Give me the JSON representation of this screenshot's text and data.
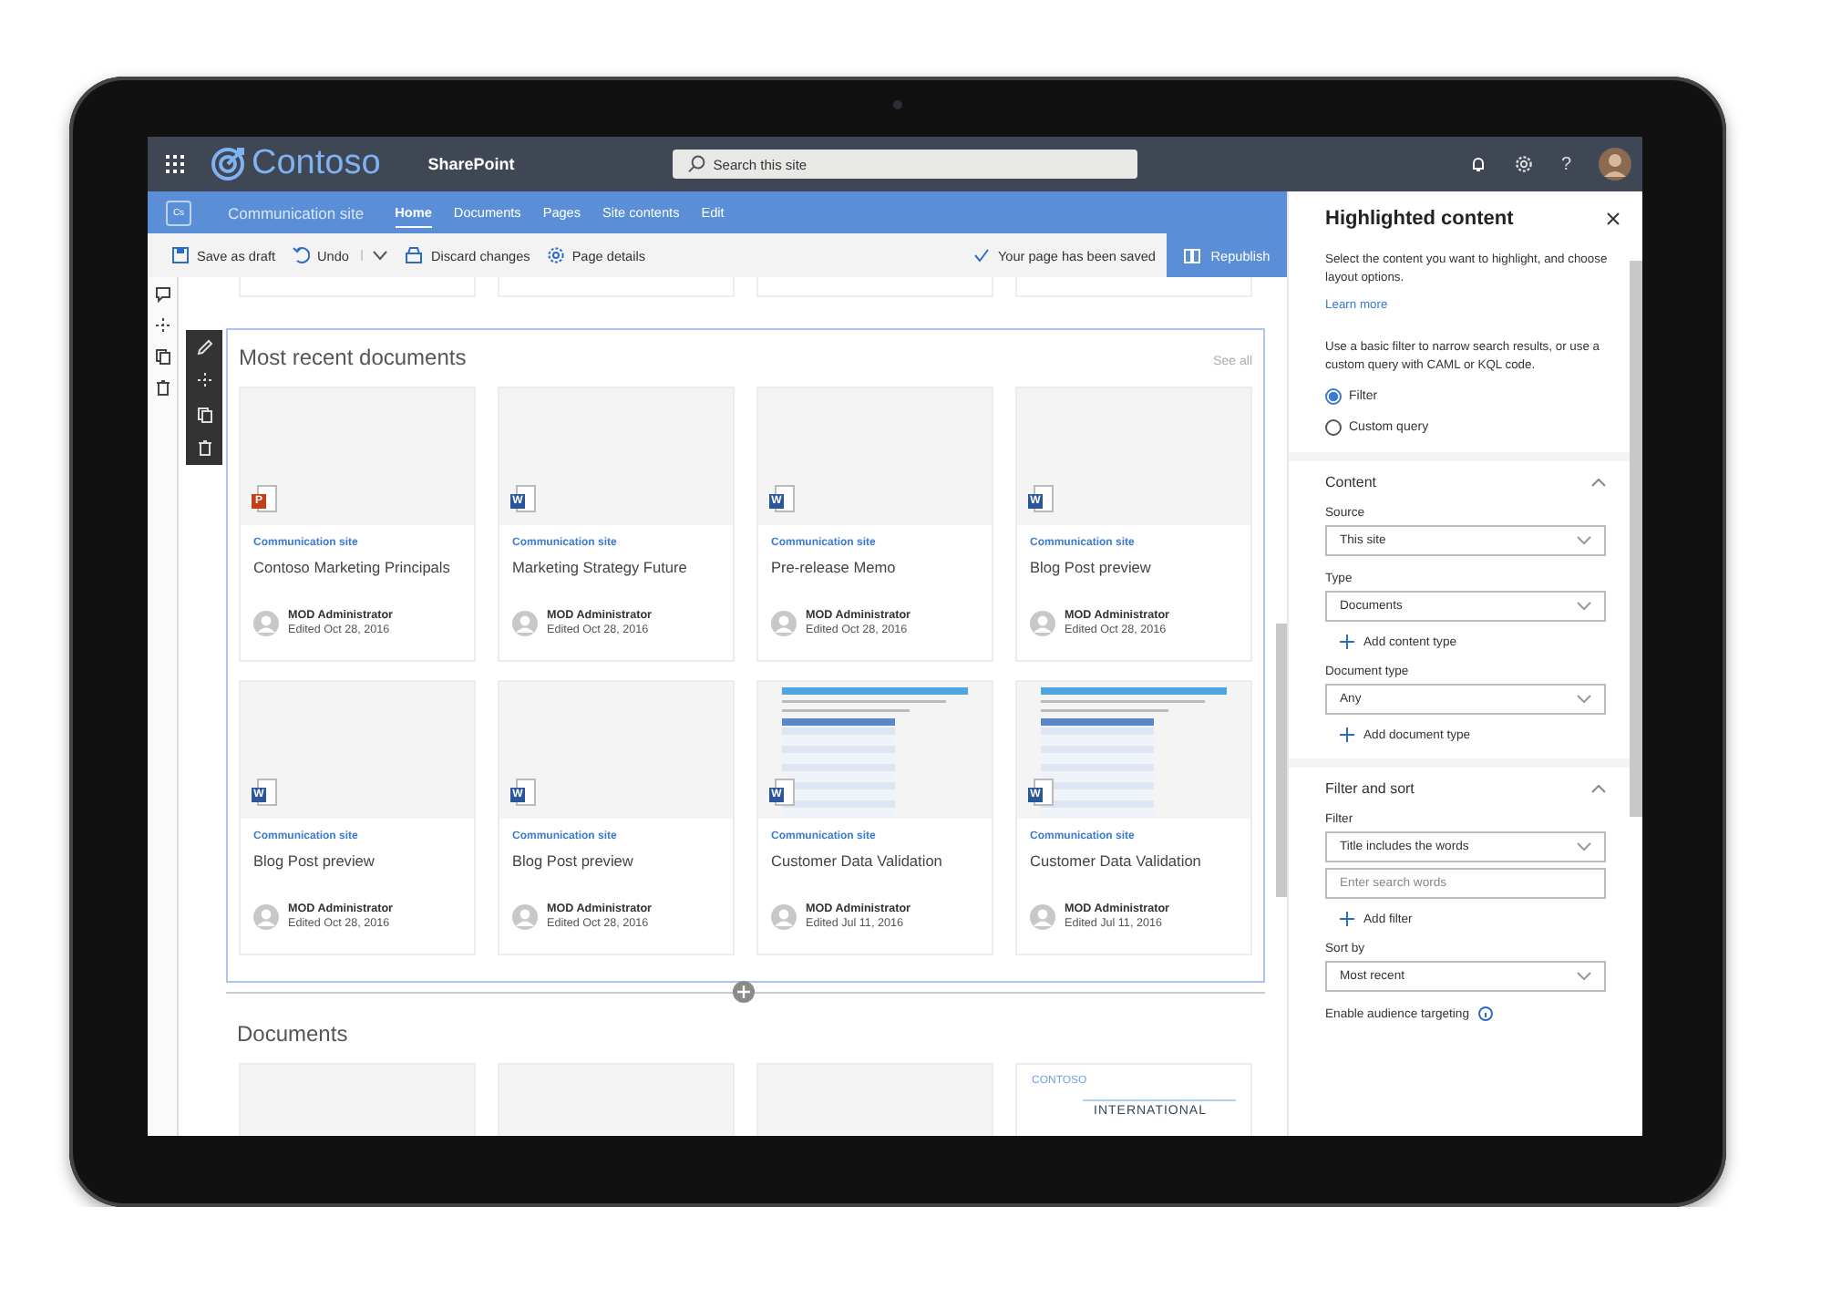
{
  "suite_bar": {
    "brand": "Contoso",
    "product": "SharePoint",
    "search_placeholder": "Search this site",
    "help": "?"
  },
  "site_header": {
    "logo": "Cs",
    "title": "Communication site",
    "nav": [
      {
        "label": "Home",
        "selected": true
      },
      {
        "label": "Documents",
        "selected": false
      },
      {
        "label": "Pages",
        "selected": false
      },
      {
        "label": "Site contents",
        "selected": false
      },
      {
        "label": "Edit",
        "selected": false
      }
    ]
  },
  "command_bar": {
    "items": [
      {
        "label": "Save as draft",
        "kind": "save"
      },
      {
        "label": "Undo",
        "kind": "undo"
      },
      {
        "label": "Discard changes",
        "kind": "discard"
      },
      {
        "label": "Page details",
        "kind": "details"
      }
    ],
    "status": "Your page has been saved",
    "publish": "Republish"
  },
  "recent_section": {
    "title": "Most recent documents",
    "see_all": "See all",
    "cards": [
      {
        "kind": "slides",
        "site": "Communication site",
        "title": "Contoso Marketing Principals",
        "author": "MOD Administrator",
        "edited": "Edited Oct 28, 2016",
        "badge": "P"
      },
      {
        "kind": "document",
        "site": "Communication site",
        "title": "Marketing Strategy Future",
        "author": "MOD Administrator",
        "edited": "Edited Oct 28, 2016",
        "badge": "W"
      },
      {
        "kind": "document",
        "site": "Communication site",
        "title": "Pre-release Memo",
        "author": "MOD Administrator",
        "edited": "Edited Oct 28, 2016",
        "badge": "W"
      },
      {
        "kind": "document",
        "site": "Communication site",
        "title": "Blog Post preview",
        "author": "MOD Administrator",
        "edited": "Edited Oct 28, 2016",
        "badge": "W"
      },
      {
        "kind": "document",
        "site": "Communication site",
        "title": "Blog Post preview",
        "author": "MOD Administrator",
        "edited": "Edited Oct 28, 2016",
        "badge": "W"
      },
      {
        "kind": "document",
        "site": "Communication site",
        "title": "Blog Post preview",
        "author": "MOD Administrator",
        "edited": "Edited Oct 28, 2016",
        "badge": "W"
      },
      {
        "kind": "table-document",
        "site": "Communication site",
        "title": "Customer Data Validation",
        "author": "MOD Administrator",
        "edited": "Edited Jul 11, 2016",
        "badge": "W"
      },
      {
        "kind": "table-document",
        "site": "Communication site",
        "title": "Customer Data Validation",
        "author": "MOD Administrator",
        "edited": "Edited Jul 11, 2016",
        "badge": "W"
      }
    ]
  },
  "documents_section": {
    "title": "Documents",
    "cards": [
      {
        "kind": "blank"
      },
      {
        "kind": "blank"
      },
      {
        "kind": "blank"
      },
      {
        "kind": "brochure",
        "preview_texts": [
          "CONTOSO",
          "INTERNATIONAL"
        ]
      }
    ]
  },
  "panel": {
    "title": "Highlighted content",
    "intro": "Select the content you want to highlight, and choose layout options.",
    "learn_more": "Learn more",
    "description": "Use a basic filter to narrow search results, or use a custom query with CAML or KQL code.",
    "modes": [
      {
        "label": "Filter",
        "selected": true
      },
      {
        "label": "Custom query",
        "selected": false
      }
    ],
    "groups": [
      {
        "title": "Content",
        "expanded": true,
        "controls": [
          {
            "kind": "label",
            "text": "Source"
          },
          {
            "kind": "dropdown",
            "value": "This site"
          },
          {
            "kind": "label",
            "text": "Type"
          },
          {
            "kind": "dropdown",
            "value": "Documents"
          },
          {
            "kind": "add",
            "text": "Add content type"
          },
          {
            "kind": "label",
            "text": "Document type"
          },
          {
            "kind": "dropdown",
            "value": "Any"
          },
          {
            "kind": "add",
            "text": "Add document type"
          }
        ]
      },
      {
        "title": "Filter and sort",
        "expanded": true,
        "controls": [
          {
            "kind": "label",
            "text": "Filter"
          },
          {
            "kind": "dropdown",
            "value": "Title includes the words"
          },
          {
            "kind": "input",
            "placeholder": "Enter search words"
          },
          {
            "kind": "add",
            "text": "Add filter"
          },
          {
            "kind": "label",
            "text": "Sort by"
          },
          {
            "kind": "dropdown",
            "value": "Most recent"
          },
          {
            "kind": "info",
            "text": "Enable audience targeting"
          }
        ]
      }
    ]
  }
}
